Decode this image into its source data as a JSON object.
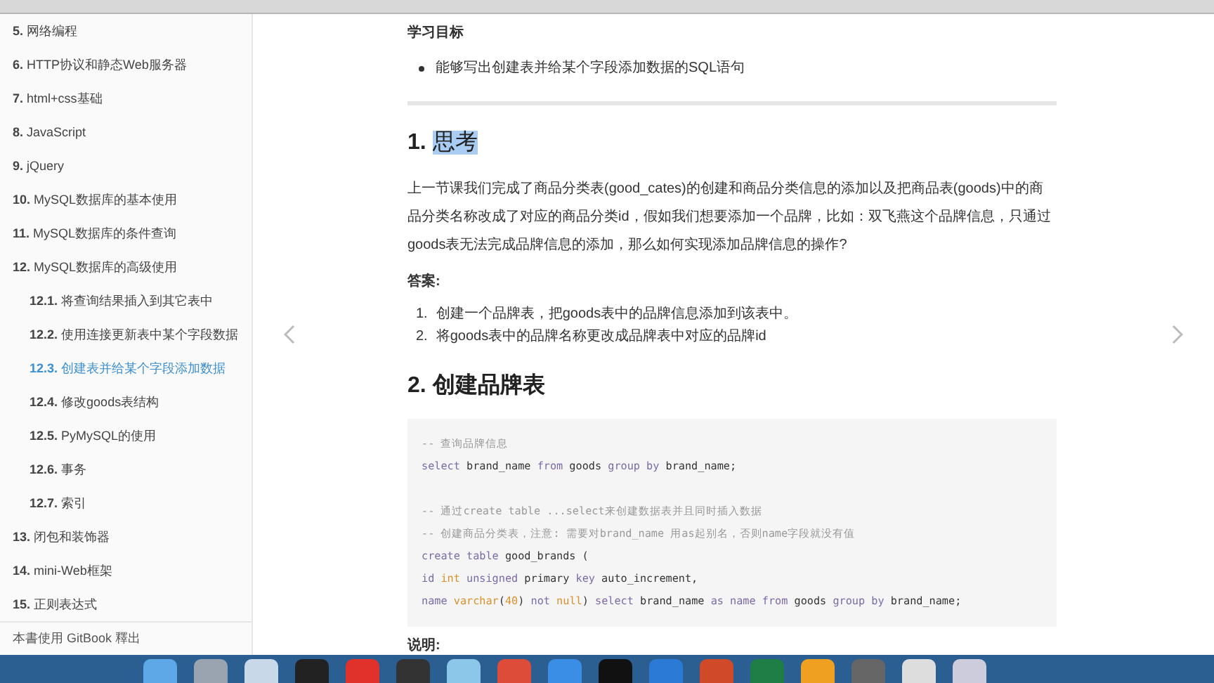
{
  "sidebar": {
    "items": [
      {
        "number": "5.",
        "label": "网络编程",
        "selected": false
      },
      {
        "number": "6.",
        "label": "HTTP协议和静态Web服务器",
        "selected": false
      },
      {
        "number": "7.",
        "label": "html+css基础",
        "selected": false
      },
      {
        "number": "8.",
        "label": "JavaScript",
        "selected": false
      },
      {
        "number": "9.",
        "label": "jQuery",
        "selected": false
      },
      {
        "number": "10.",
        "label": "MySQL数据库的基本使用",
        "selected": false
      },
      {
        "number": "11.",
        "label": "MySQL数据库的条件查询",
        "selected": false
      },
      {
        "number": "12.",
        "label": "MySQL数据库的高级使用",
        "selected": false,
        "children": [
          {
            "number": "12.1.",
            "label": "将查询结果插入到其它表中",
            "selected": false
          },
          {
            "number": "12.2.",
            "label": "使用连接更新表中某个字段数据",
            "selected": false
          },
          {
            "number": "12.3.",
            "label": "创建表并给某个字段添加数据",
            "selected": true
          },
          {
            "number": "12.4.",
            "label": "修改goods表结构",
            "selected": false
          },
          {
            "number": "12.5.",
            "label": "PyMySQL的使用",
            "selected": false
          },
          {
            "number": "12.6.",
            "label": "事务",
            "selected": false
          },
          {
            "number": "12.7.",
            "label": "索引",
            "selected": false
          }
        ]
      },
      {
        "number": "13.",
        "label": "闭包和装饰器",
        "selected": false
      },
      {
        "number": "14.",
        "label": "mini-Web框架",
        "selected": false
      },
      {
        "number": "15.",
        "label": "正则表达式",
        "selected": false
      }
    ],
    "footer": "本書使用 GitBook 釋出"
  },
  "article": {
    "goal_title": "学习目标",
    "goals": [
      "能够写出创建表并给某个字段添加数据的SQL语句"
    ],
    "section1": {
      "number": "1.",
      "title": "思考",
      "highlighted": true
    },
    "paragraph": "上一节课我们完成了商品分类表(good_cates)的创建和商品分类信息的添加以及把商品表(goods)中的商品分类名称改成了对应的商品分类id，假如我们想要添加一个品牌，比如：双飞燕这个品牌信息，只通过goods表无法完成品牌信息的添加，那么如何实现添加品牌信息的操作?",
    "answer_title": "答案:",
    "answers": [
      {
        "number": "1.",
        "text": "创建一个品牌表，把goods表中的品牌信息添加到该表中。"
      },
      {
        "number": "2.",
        "text": "将goods表中的品牌名称更改成品牌表中对应的品牌id"
      }
    ],
    "section2": {
      "number": "2.",
      "title": "创建品牌表",
      "highlighted": false
    },
    "code": [
      {
        "kind": "code",
        "tokens": [
          {
            "kind": "comment",
            "text": "-- 查询品牌信息"
          }
        ]
      },
      {
        "kind": "code",
        "tokens": [
          {
            "kind": "keyword",
            "text": "select"
          },
          {
            "kind": "plain",
            "text": " brand_name "
          },
          {
            "kind": "keyword",
            "text": "from"
          },
          {
            "kind": "plain",
            "text": " goods "
          },
          {
            "kind": "keyword",
            "text": "group by"
          },
          {
            "kind": "plain",
            "text": " brand_name;"
          }
        ]
      },
      {
        "kind": "blank"
      },
      {
        "kind": "code",
        "tokens": [
          {
            "kind": "comment",
            "text": "-- 通过create table ...select来创建数据表并且同时插入数据"
          }
        ]
      },
      {
        "kind": "code",
        "tokens": [
          {
            "kind": "comment",
            "text": "-- 创建商品分类表，注意: 需要对brand_name 用as起别名，否则name字段就没有值"
          }
        ]
      },
      {
        "kind": "code",
        "tokens": [
          {
            "kind": "keyword",
            "text": "create table"
          },
          {
            "kind": "plain",
            "text": " good_brands ("
          }
        ]
      },
      {
        "kind": "code",
        "tokens": [
          {
            "kind": "keyword",
            "text": "id"
          },
          {
            "kind": "type",
            "text": " int"
          },
          {
            "kind": "keyword",
            "text": " unsigned"
          },
          {
            "kind": "plain",
            "text": " primary "
          },
          {
            "kind": "keyword",
            "text": "key"
          },
          {
            "kind": "plain",
            "text": " auto_increment,"
          }
        ]
      },
      {
        "kind": "code",
        "tokens": [
          {
            "kind": "keyword",
            "text": "name"
          },
          {
            "kind": "type",
            "text": " varchar"
          },
          {
            "kind": "plain",
            "text": "("
          },
          {
            "kind": "type",
            "text": "40"
          },
          {
            "kind": "plain",
            "text": ") "
          },
          {
            "kind": "keyword",
            "text": "not"
          },
          {
            "kind": "type",
            "text": " null"
          },
          {
            "kind": "plain",
            "text": ") "
          },
          {
            "kind": "keyword",
            "text": "select"
          },
          {
            "kind": "plain",
            "text": " brand_name "
          },
          {
            "kind": "keyword",
            "text": "as"
          },
          {
            "kind": "keyword",
            "text": " name"
          },
          {
            "kind": "keyword",
            "text": " from"
          },
          {
            "kind": "plain",
            "text": " goods "
          },
          {
            "kind": "keyword",
            "text": "group by"
          },
          {
            "kind": "plain",
            "text": " brand_name;"
          }
        ]
      }
    ],
    "note_title": "说明:"
  }
}
